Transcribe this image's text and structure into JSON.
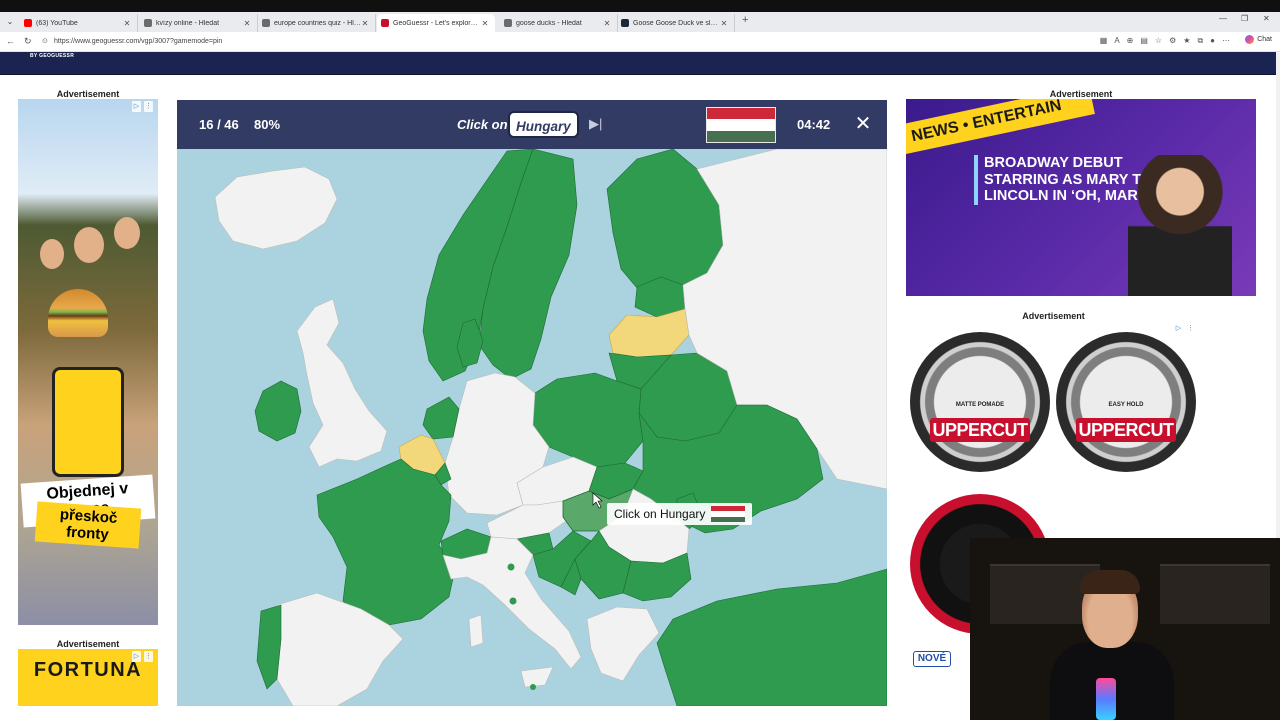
{
  "browser": {
    "tabs": [
      {
        "title": "(63) YouTube",
        "color": "#ff0000"
      },
      {
        "title": "kvízy online - Hledat",
        "color": "#6b6b6b"
      },
      {
        "title": "europe countries quiz - Hledat",
        "color": "#6b6b6b"
      },
      {
        "title": "GeoGuessr - Let's explore the wor",
        "color": "#c8102e"
      },
      {
        "title": "goose ducks - Hledat",
        "color": "#6b6b6b"
      },
      {
        "title": "Goose Goose Duck ve službě Stea",
        "color": "#1b2838"
      }
    ],
    "active_tab": 3,
    "url": "https://www.geoguessr.com/vgp/3007?gamemode=pin",
    "chat_label": "Chat"
  },
  "site": {
    "brand_by": "BY",
    "brand_name": "GEOGUESSR"
  },
  "ads": {
    "label": "Advertisement",
    "left_top": {
      "headline": "Objednej v appce,",
      "subline": "přeskoč fronty"
    },
    "left_bottom": {
      "logo": "FORTUNA"
    },
    "right_top": {
      "banner": "NEWS • ENTERTAIN",
      "headline": "BROADWAY DEBUT STARRING AS MARY TODD LINCOLN IN ‘OH, MARY!’"
    },
    "right_bottom": {
      "products": [
        {
          "brand": "UPPERCUT",
          "label": "MATTE POMADE"
        },
        {
          "brand": "UPPERCUT",
          "label": "EASY HOLD"
        }
      ],
      "badge": "NOVÉ"
    }
  },
  "game": {
    "progress": "16 / 46",
    "accuracy": "80%",
    "prompt": "Click on",
    "target_country": "Hungary",
    "timer": "04:42",
    "flag_colors": [
      "#ce2939",
      "#ffffff",
      "#477050"
    ],
    "tooltip_text": "Click on Hungary",
    "colors": {
      "sea": "#aad3df",
      "correct": "#2e9b4f",
      "wrong": "#f3d77b",
      "unanswered": "#f2f2f2",
      "hover": "#5aa86a",
      "header": "#323b63"
    }
  }
}
